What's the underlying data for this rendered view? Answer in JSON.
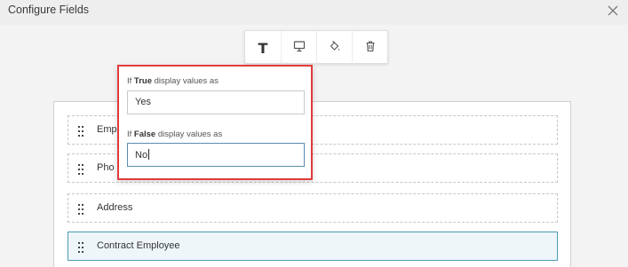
{
  "header": {
    "title": "Configure Fields"
  },
  "icons": {
    "close": "close-icon",
    "text": "text-format-icon",
    "monitor": "monitor-icon",
    "paint": "paint-bucket-icon",
    "trash": "trash-icon",
    "drag": "drag-handle-icon"
  },
  "toolbar": {
    "text_tool_label": "T"
  },
  "fields": [
    {
      "label": "Emp"
    },
    {
      "label": "Pho"
    },
    {
      "label": "Address"
    },
    {
      "label": "Contract Employee"
    }
  ],
  "popup": {
    "true_prefix": "If ",
    "true_keyword": "True",
    "true_suffix": " display values as",
    "true_value": "Yes",
    "false_prefix": "If ",
    "false_keyword": "False",
    "false_suffix": " display values as",
    "false_value": "No"
  },
  "colors": {
    "highlight_border": "#e23b3b",
    "selected_border": "#4e9bb5",
    "selected_bg": "#eef6fa"
  }
}
